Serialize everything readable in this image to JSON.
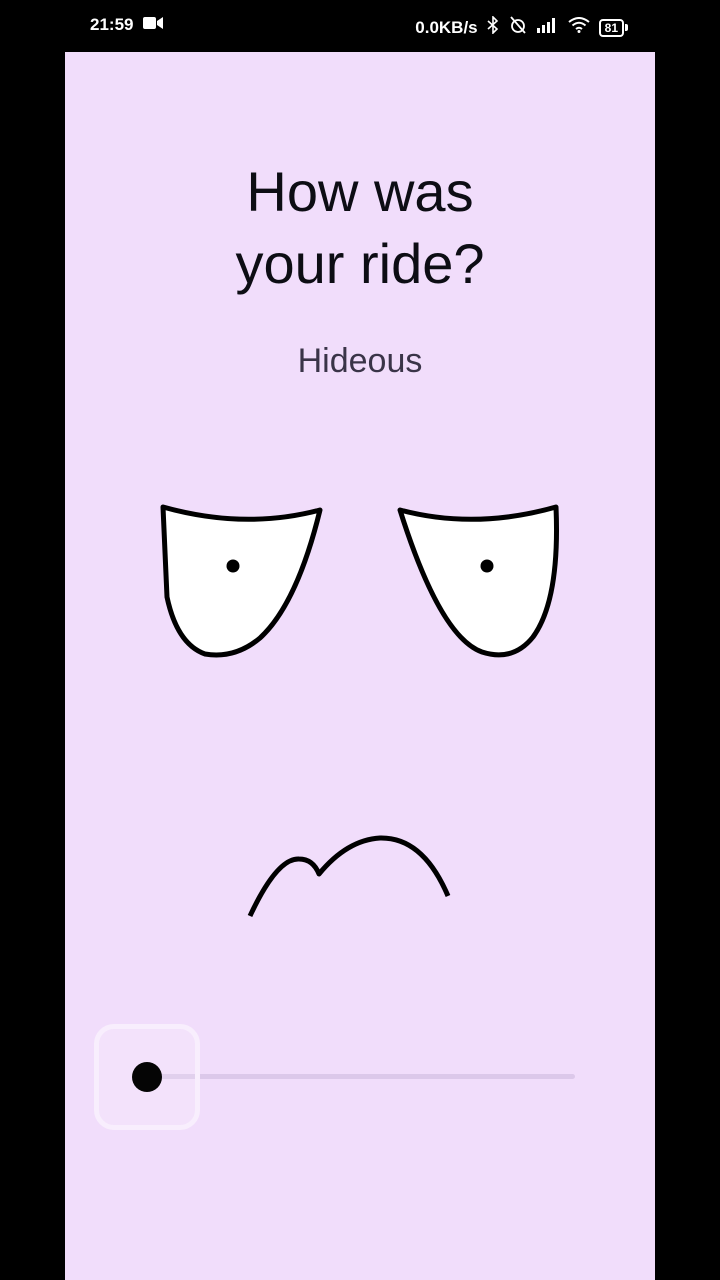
{
  "status_bar": {
    "time": "21:59",
    "network_speed": "0.0KB/s",
    "battery_level": "81",
    "icons": [
      "video-camera-icon",
      "bluetooth-icon",
      "alarm-off-icon",
      "signal-icon",
      "wifi-icon",
      "battery-icon"
    ]
  },
  "screen": {
    "title_line1": "How was",
    "title_line2": "your ride?",
    "rating_label": "Hideous",
    "background_color": "#f1ddfb"
  },
  "slider": {
    "value_fraction": 0.0,
    "track_color": "#dcc8ea",
    "thumb_color": "#050505"
  }
}
